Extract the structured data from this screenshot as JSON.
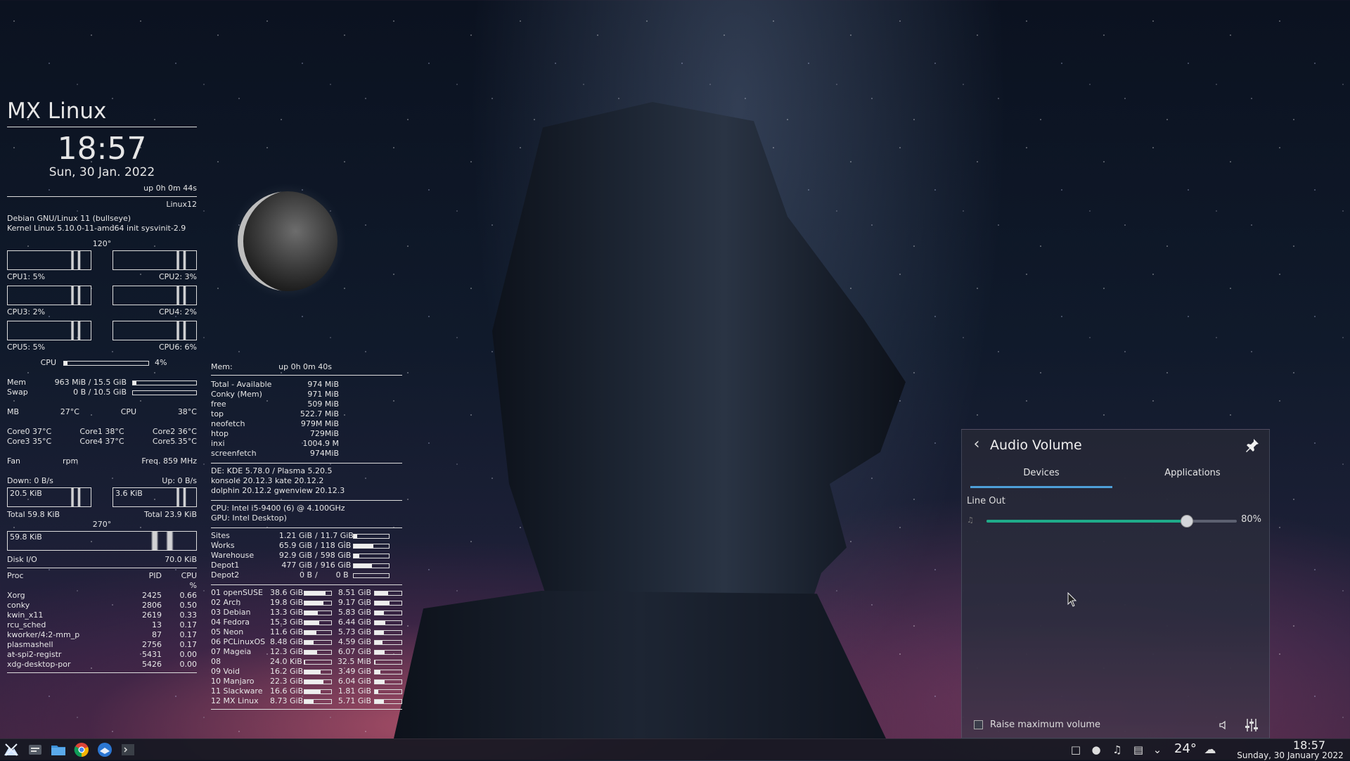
{
  "conky": {
    "distro": "MX Linux",
    "time": "18:57",
    "date": "Sun, 30 Jan. 2022",
    "uptime": "up  0h 0m 44s",
    "host": "Linux12",
    "os": "Debian GNU/Linux 11 (bullseye)",
    "kernel": "Kernel Linux 5.10.0-11-amd64  init  sysvinit-2.9",
    "angle_top": "120°",
    "cpus": [
      "CPU1: 5%",
      "CPU2: 3%",
      "CPU3: 2%",
      "CPU4: 2%",
      "CPU5: 5%",
      "CPU6: 6%"
    ],
    "cpu_total_label": "CPU",
    "cpu_total_value": "4%",
    "cpu_total_fraction": 0.04,
    "mem_label": "Mem",
    "mem_value": "963 MiB / 15.5 GiB",
    "mem_fraction": 0.06,
    "swap_label": "Swap",
    "swap_value": "0 B / 10.5 GiB",
    "swap_fraction": 0,
    "mb_label": "MB",
    "mb_temp": "27°C",
    "cpu_temp_label": "CPU",
    "cpu_temp": "38°C",
    "cores": [
      [
        "Core0  37°C",
        "Core1  38°C",
        "Core2  36°C"
      ],
      [
        "Core3  35°C",
        "Core4  37°C",
        "Core5  35°C"
      ]
    ],
    "fan_label": "Fan",
    "fan_unit": "rpm",
    "freq_label": "Freq.  859   MHz",
    "down": "Down: 0 B/s",
    "up": "Up: 0 B/s",
    "down_graph": "20.5 KiB",
    "up_graph": "3.6 KiB",
    "total_down": "Total 59.8 KiB",
    "total_up": "Total 23.9 KiB",
    "angle_bottom": "270°",
    "disk_graph": "59.8 KiB",
    "disk_io_label": "Disk I/O",
    "disk_io_value": "70.0 KiB",
    "proc_header": {
      "name": "Proc",
      "pid": "PID",
      "cpu": "CPU",
      "unit": "%"
    },
    "procs": [
      {
        "name": "Xorg",
        "pid": "2425",
        "cpu": "0.66"
      },
      {
        "name": "conky",
        "pid": "2806",
        "cpu": "0.50"
      },
      {
        "name": "kwin_x11",
        "pid": "2619",
        "cpu": "0.33"
      },
      {
        "name": "rcu_sched",
        "pid": "13",
        "cpu": "0.17"
      },
      {
        "name": "kworker/4:2-mm_p",
        "pid": "87",
        "cpu": "0.17"
      },
      {
        "name": "plasmashell",
        "pid": "2756",
        "cpu": "0.17"
      },
      {
        "name": "at-spi2-registr",
        "pid": "5431",
        "cpu": "0.00"
      },
      {
        "name": "xdg-desktop-por",
        "pid": "5426",
        "cpu": "0.00"
      }
    ]
  },
  "conky2": {
    "mem_label": "Mem:",
    "mem_uptime": "up  0h 0m 40s",
    "mem_rows": [
      {
        "k": "Total - Available",
        "v": "974 MiB"
      },
      {
        "k": "Conky (Mem)",
        "v": "971 MiB"
      },
      {
        "k": "free",
        "v": "509    MiB"
      },
      {
        "k": "top",
        "v": "522.7  MiB"
      },
      {
        "k": "neofetch",
        "v": "979M MiB"
      },
      {
        "k": "htop",
        "v": "729MiB"
      },
      {
        "k": "inxi",
        "v": "1004.9 M"
      },
      {
        "k": "screenfetch",
        "v": "974MiB"
      }
    ],
    "de": "DE: KDE 5.78.0 / Plasma 5.20.5",
    "apps_line1": "konsole 20.12.3             kate 20.12.2",
    "apps_line2": "dolphin 20.12.2    gwenview 20.12.3",
    "cpu": "CPU: Intel i5-9400 (6) @ 4.100GHz",
    "gpu": "GPU: Intel Desktop)",
    "disks": [
      {
        "name": "Sites",
        "used": "1.21 GiB",
        "total": "11.7 GiB",
        "fraction": 0.1
      },
      {
        "name": "Works",
        "used": "65.9 GiB",
        "total": "118 GiB",
        "fraction": 0.56
      },
      {
        "name": "Warehouse",
        "used": "92.9 GiB",
        "total": "598 GiB",
        "fraction": 0.16
      },
      {
        "name": "Depot1",
        "used": "477 GiB",
        "total": "916 GiB",
        "fraction": 0.52
      },
      {
        "name": "Depot2",
        "used": "0 B",
        "total": "0 B",
        "fraction": 0
      }
    ],
    "dists": [
      {
        "name": "01 openSUSE",
        "a": "38.6 GiB",
        "af": 0.8,
        "b": "8.51 GiB",
        "bf": 0.5
      },
      {
        "name": "02 Arch",
        "a": "19.8 GiB",
        "af": 0.7,
        "b": "9.17 GiB",
        "bf": 0.55
      },
      {
        "name": "03 Debian",
        "a": "13.3 GiB",
        "af": 0.5,
        "b": "5.83 GiB",
        "bf": 0.35
      },
      {
        "name": "04 Fedora",
        "a": "15.3 GiB",
        "af": 0.55,
        "b": "6.44 GiB",
        "bf": 0.4
      },
      {
        "name": "05 Neon",
        "a": "11.6 GiB",
        "af": 0.45,
        "b": "5.73 GiB",
        "bf": 0.35
      },
      {
        "name": "06 PCLinuxOS",
        "a": "8.48 GiB",
        "af": 0.35,
        "b": "4.59 GiB",
        "bf": 0.28
      },
      {
        "name": "07 Mageia",
        "a": "12.3 GiB",
        "af": 0.48,
        "b": "6.07 GiB",
        "bf": 0.36
      },
      {
        "name": "08",
        "a": "24.0 KiB",
        "af": 0.02,
        "b": "32.5 MiB",
        "bf": 0.03
      },
      {
        "name": "09 Void",
        "a": "16.2 GiB",
        "af": 0.6,
        "b": "3.49 GiB",
        "bf": 0.22
      },
      {
        "name": "10 Manjaro",
        "a": "22.3 GiB",
        "af": 0.72,
        "b": "6.04 GiB",
        "bf": 0.36
      },
      {
        "name": "11 Slackware",
        "a": "16.6 GiB",
        "af": 0.6,
        "b": "1.81 GiB",
        "bf": 0.12
      },
      {
        "name": "12 MX Linux",
        "a": "8.73 GiB",
        "af": 0.35,
        "b": "5.71 GiB",
        "bf": 0.35
      }
    ]
  },
  "audio": {
    "title": "Audio Volume",
    "tabs": [
      "Devices",
      "Applications"
    ],
    "device_name": "Line Out",
    "volume_label": "80%",
    "volume_fraction": 0.8,
    "raise_max_label": "Raise maximum volume"
  },
  "taskbar": {
    "temperature": "24°",
    "time": "18:57",
    "date": "Sunday, 30 January 2022"
  },
  "colors": {
    "accent": "#1fab89",
    "tab_indicator": "#4e9fd8"
  }
}
